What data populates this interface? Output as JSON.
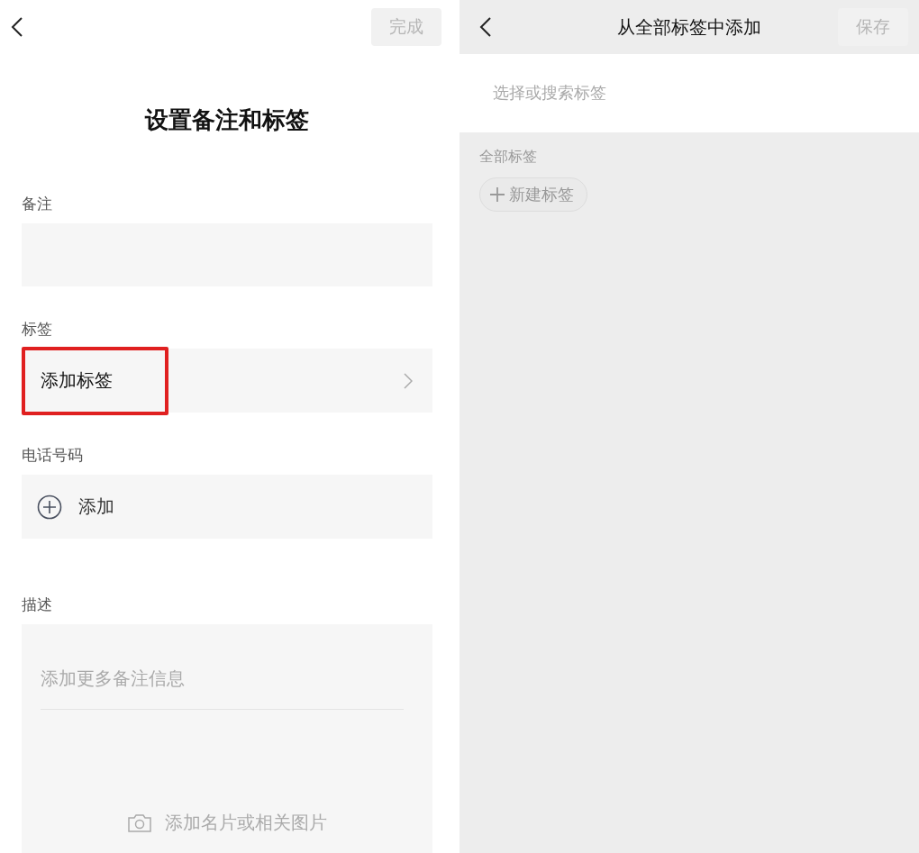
{
  "left": {
    "done_button": {
      "label": "完成",
      "disabled": true
    },
    "title": "设置备注和标签",
    "remark": {
      "label": "备注"
    },
    "tags": {
      "label": "标签",
      "row": {
        "label": "添加标签",
        "highlighted": true
      }
    },
    "phone": {
      "label": "电话号码",
      "add_label": "添加"
    },
    "description": {
      "label": "描述",
      "placeholder": "添加更多备注信息",
      "photo_label": "添加名片或相关图片"
    }
  },
  "right": {
    "title": "从全部标签中添加",
    "save_button": {
      "label": "保存",
      "disabled": true
    },
    "search": {
      "placeholder": "选择或搜索标签"
    },
    "section_label": "全部标签",
    "new_tag_label": "新建标签"
  }
}
